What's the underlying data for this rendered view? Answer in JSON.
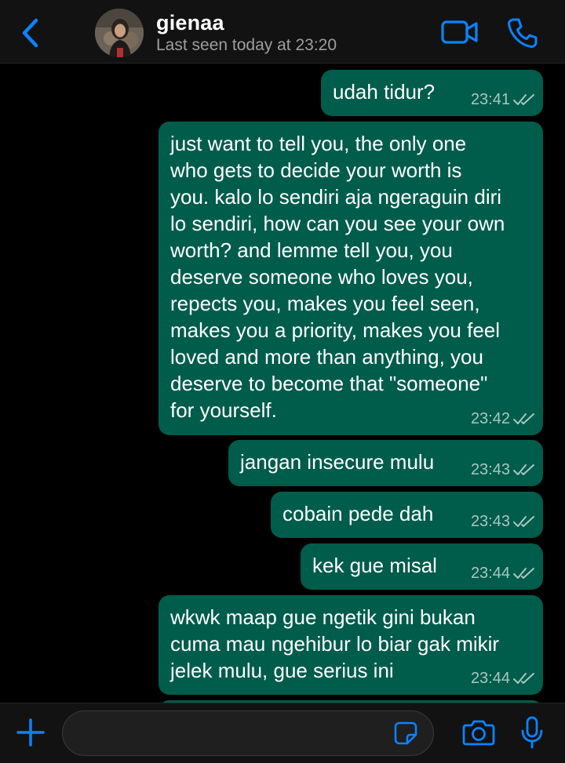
{
  "header": {
    "contact_name": "gienaa",
    "last_seen": "Last seen today at 23:20"
  },
  "messages": [
    {
      "text": "udah tidur?",
      "time": "23:41"
    },
    {
      "text": "just want to tell you, the only one\nwho gets to decide your worth is\nyou. kalo lo sendiri aja ngeraguin diri\nlo sendiri, how can you see your own\nworth? and lemme tell you, you\ndeserve someone who loves you,\nrepects you, makes you feel seen,\nmakes you a priority, makes you feel\nloved and more than anything, you\ndeserve to become that \"someone\"\nfor yourself.",
      "time": "23:42"
    },
    {
      "text": "jangan insecure mulu",
      "time": "23:43"
    },
    {
      "text": "cobain pede dah",
      "time": "23:43"
    },
    {
      "text": "kek gue misal",
      "time": "23:44"
    },
    {
      "text": "wkwk maap gue ngetik gini bukan\ncuma mau ngehibur lo biar gak mikir\njelek mulu, gue serius ini",
      "time": "23:44"
    }
  ],
  "input": {
    "value": "",
    "placeholder": ""
  },
  "icons": {
    "back": "chevron-left-icon",
    "video": "video-camera-icon",
    "call": "phone-icon",
    "plus": "plus-icon",
    "sticker": "sticker-icon",
    "camera": "camera-icon",
    "mic": "microphone-icon",
    "read_receipt": "double-check-icon"
  },
  "colors": {
    "accent": "#0a84ff",
    "outgoing_bubble": "#005c4b",
    "background": "#000000",
    "bar": "#121212"
  }
}
